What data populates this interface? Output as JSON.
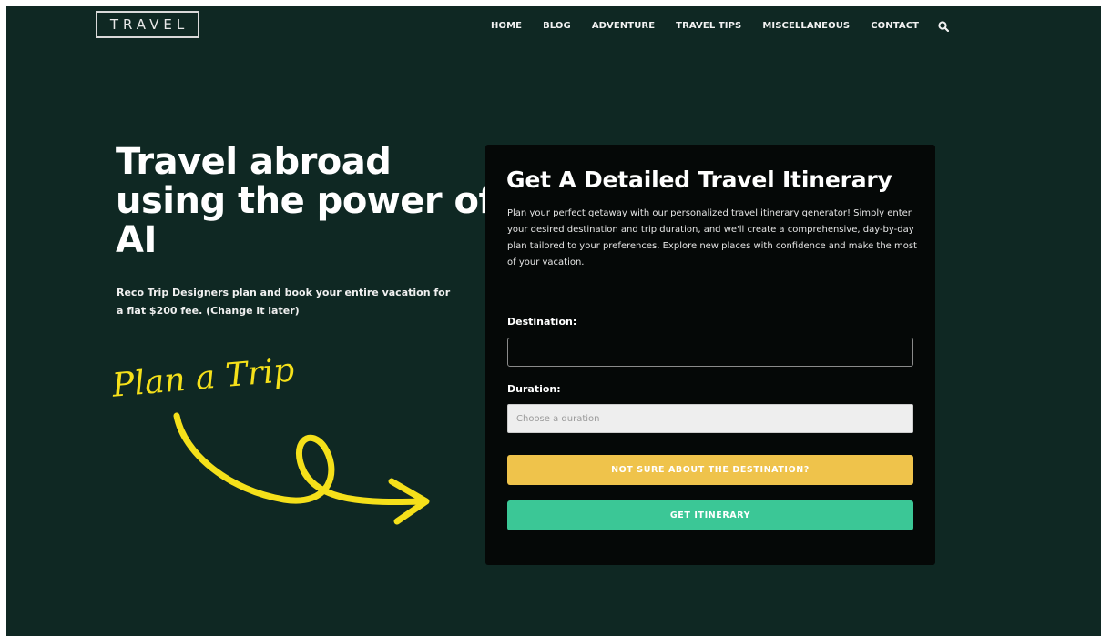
{
  "header": {
    "logo": "TRAVEL",
    "nav": [
      "HOME",
      "BLOG",
      "ADVENTURE",
      "TRAVEL TIPS",
      "MISCELLANEOUS",
      "CONTACT"
    ],
    "search_icon": "search-icon"
  },
  "hero": {
    "title": "Travel abroad using the power of AI",
    "subtitle": "Reco Trip Designers plan and book your entire vacation for a flat $200 fee. (Change it later)",
    "plan_text": "Plan a Trip",
    "accent_color": "#f5e01a"
  },
  "card": {
    "title": "Get A Detailed Travel Itinerary",
    "description": "Plan your perfect getaway with our personalized travel itinerary generator! Simply enter your desired destination and trip duration, and we'll create a comprehensive, day-by-day plan tailored to your preferences. Explore new places with confidence and make the most of your vacation.",
    "destination_label": "Destination:",
    "destination_value": "",
    "duration_label": "Duration:",
    "duration_placeholder": "Choose a duration",
    "secondary_button": "NOT SURE ABOUT THE DESTINATION?",
    "primary_button": "GET ITINERARY"
  },
  "colors": {
    "background": "#0f2823",
    "card": "#050807",
    "yellow_button": "#efc34b",
    "green_button": "#3bc796"
  }
}
